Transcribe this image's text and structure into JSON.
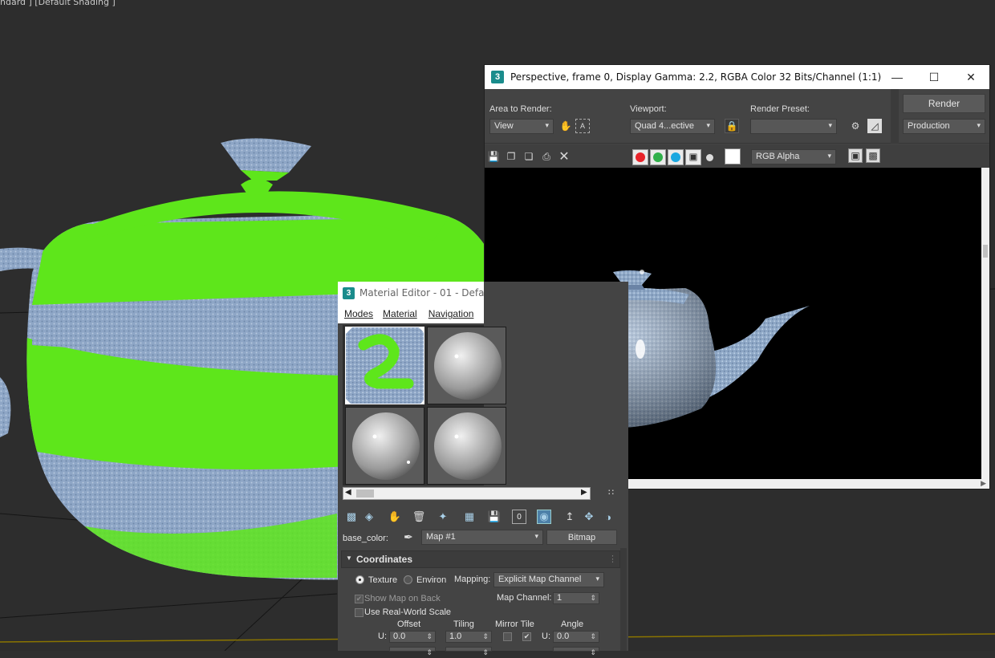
{
  "viewport": {
    "label": "ndard ] [Default Shading ]",
    "colors": {
      "bg": "#2d2d2d",
      "green": "#5ee61b",
      "fabric": "#8ea6c6",
      "grid": "#151515",
      "axis": "#8a7400"
    }
  },
  "render_window": {
    "title": "Perspective, frame 0, Display Gamma: 2.2, RGBA Color 32 Bits/Channel (1:1)",
    "logo": "3",
    "area_to_render_label": "Area to Render:",
    "area_to_render_value": "View",
    "viewport_label": "Viewport:",
    "viewport_value": "Quad 4...ective",
    "render_preset_label": "Render Preset:",
    "render_preset_value": "",
    "render_button": "Render",
    "production_value": "Production",
    "channel_value": "RGB Alpha",
    "colors": {
      "red": "#e8232a",
      "green": "#30b04a",
      "blue": "#1aa7e0",
      "canvas": "#000000"
    }
  },
  "material_editor": {
    "title": "Material Editor - 01 - Defau",
    "logo": "3",
    "menus": [
      "Modes",
      "Material",
      "Navigation"
    ],
    "base_label": "base_color:",
    "map_value": "Map #1",
    "bitmap_button": "Bitmap",
    "rollout_title": "Coordinates",
    "texture_label": "Texture",
    "environ_label": "Environ",
    "mapping_label": "Mapping:",
    "mapping_value": "Explicit Map Channel",
    "show_map_label": "Show Map on Back",
    "map_channel_label": "Map Channel:",
    "map_channel_value": "1",
    "real_world_label": "Use Real-World Scale",
    "offset_header": "Offset",
    "tiling_header": "Tiling",
    "mirror_tile_header": "Mirror Tile",
    "angle_header": "Angle",
    "u_label": "U:",
    "u_offset": "0.0",
    "u_tiling": "1.0",
    "u_angle": "0.0"
  }
}
